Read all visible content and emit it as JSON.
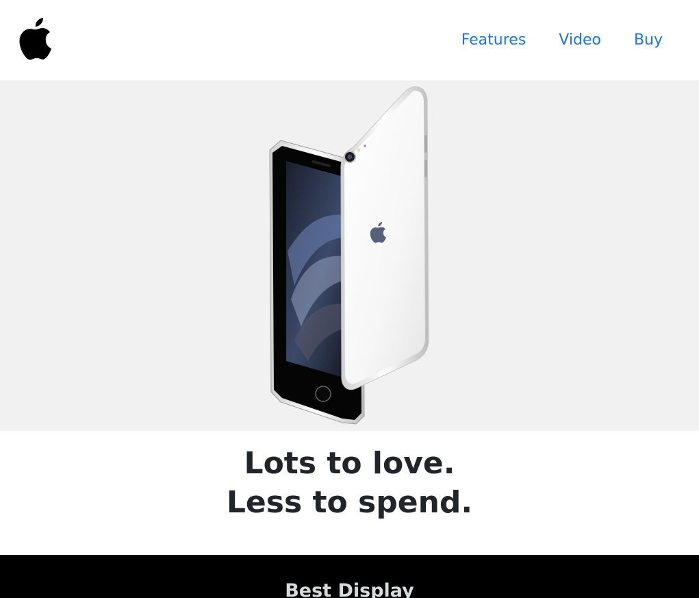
{
  "header": {
    "logo_icon": "apple-logo-icon",
    "nav": [
      {
        "label": "Features"
      },
      {
        "label": "Video"
      },
      {
        "label": "Buy"
      }
    ]
  },
  "hero": {
    "image": "iphone-se-front-back-image"
  },
  "headline": {
    "line1": "Lots to love.",
    "line2": "Less to spend."
  },
  "dark_section": {
    "title": "Best Display"
  },
  "colors": {
    "nav_link": "#1a73e8",
    "hero_bg": "#f1f1f1",
    "headline_text": "#212529",
    "dark_bg": "#000000",
    "dark_title": "#d6dcdc"
  }
}
